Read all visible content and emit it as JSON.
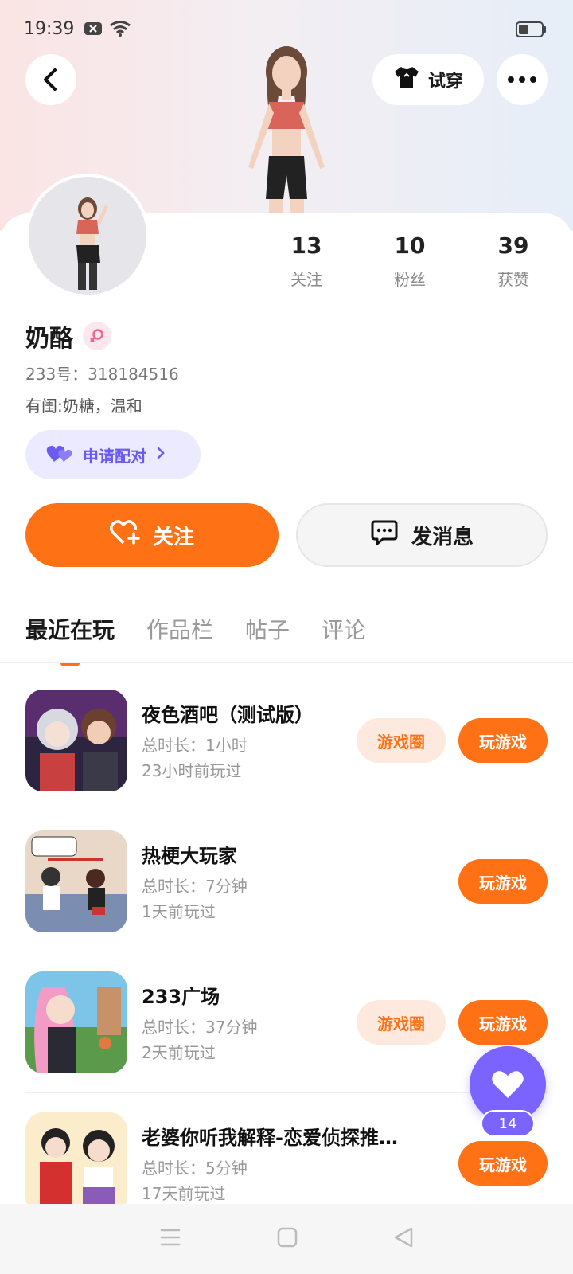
{
  "status_bar": {
    "time": "19:39",
    "icons": [
      "notification-icon",
      "wifi-icon",
      "battery-icon"
    ]
  },
  "header": {
    "tryon_label": "试穿"
  },
  "profile": {
    "name": "奶酪",
    "gender": "female",
    "uid": "233号：318184516",
    "bio": "有闺:奶糖，温和",
    "stats": [
      {
        "value": "13",
        "label": "关注"
      },
      {
        "value": "10",
        "label": "粉丝"
      },
      {
        "value": "39",
        "label": "获赞"
      }
    ],
    "pair_label": "申请配对"
  },
  "actions": {
    "follow_label": "关注",
    "message_label": "发消息"
  },
  "tabs": [
    "最近在玩",
    "作品栏",
    "帖子",
    "评论"
  ],
  "games": [
    {
      "title": "夜色酒吧（测试版）",
      "duration": "总时长：1小时",
      "last_played": "23小时前玩过",
      "circle_label": "游戏圈",
      "play_label": "玩游戏"
    },
    {
      "title": "热梗大玩家",
      "duration": "总时长：7分钟",
      "last_played": "1天前玩过",
      "play_label": "玩游戏"
    },
    {
      "title": "233广场",
      "duration": "总时长：37分钟",
      "last_played": "2天前玩过",
      "circle_label": "游戏圈",
      "play_label": "玩游戏"
    },
    {
      "title": "老婆你听我解释-恋爱侦探推…",
      "duration": "总时长：5分钟",
      "last_played": "17天前玩过",
      "play_label": "玩游戏"
    }
  ],
  "fab": {
    "count": "14"
  },
  "colors": {
    "accent": "#fe7114",
    "purple": "#7a63ff"
  }
}
